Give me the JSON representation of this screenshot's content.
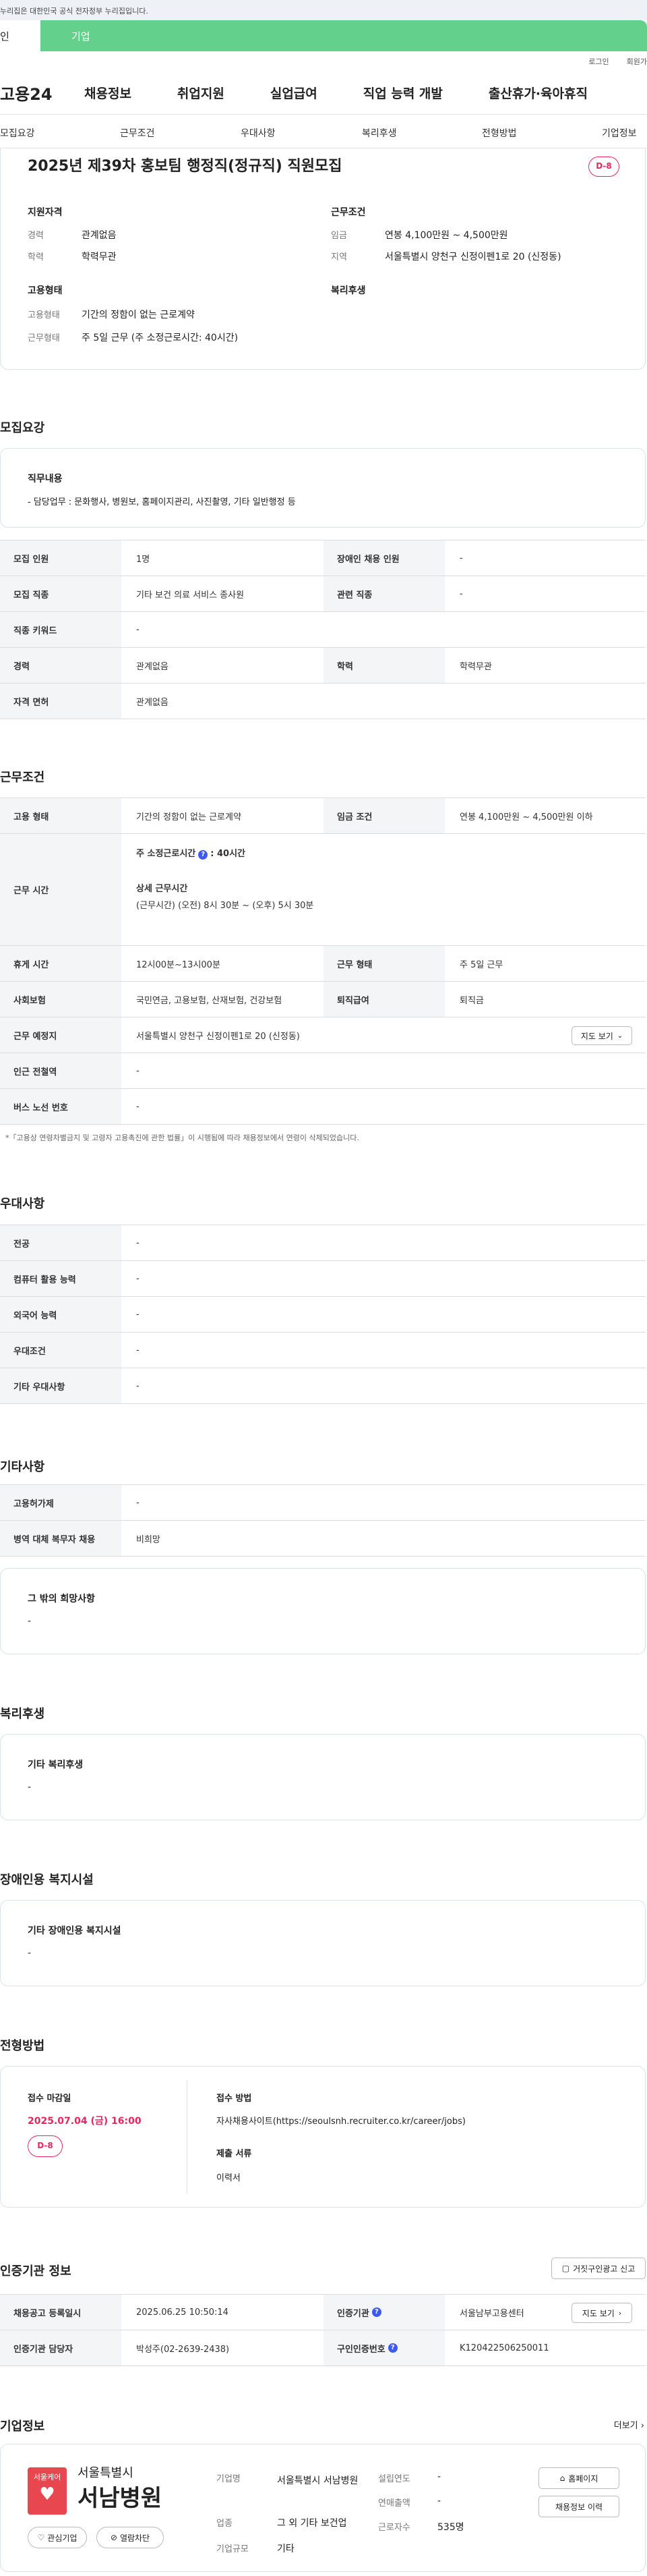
{
  "gov_banner": "누리집은 대한민국 공식 전자정부 누리집입니다.",
  "tabs": {
    "person": "인",
    "corp": "기업"
  },
  "util": {
    "login": "로그인",
    "join": "회원가"
  },
  "logo": "고용24",
  "gnb": [
    "채용정보",
    "취업지원",
    "실업급여",
    "직업 능력 개발",
    "출산휴가·육아휴직"
  ],
  "lnb": [
    "모집요강",
    "근무조건",
    "우대사항",
    "복리후생",
    "전형방법",
    "기업정보"
  ],
  "job": {
    "title": "2025년 제39차 홍보팀 행정직(정규직) 직원모집",
    "dday": "D-8",
    "qual_title": "지원자격",
    "career_l": "경력",
    "career_v": "관계없음",
    "edu_l": "학력",
    "edu_v": "학력무관",
    "cond_title": "근무조건",
    "wage_l": "임금",
    "wage_v": "연봉 4,100만원 ~ 4,500만원",
    "area_l": "지역",
    "area_v": "서울특별시 양천구 신정이펜1로 20 (신정동)",
    "emp_title": "고용형태",
    "emp_l": "고용형태",
    "emp_v": "기간의 정함이 없는 근로계약",
    "days_l": "근무형태",
    "days_v": "주 5일 근무 (주 소정근로시간: 40시간)",
    "welfare_title": "복리후생"
  },
  "recruit": {
    "heading": "모집요강",
    "duty_title": "직무내용",
    "duty_text": "- 담당업무 : 문화행사, 병원보, 홈페이지관리, 사진촬영, 기타 일반행정 등",
    "rows": [
      {
        "l1": "모집 인원",
        "v1": "1명",
        "l2": "장애인 채용 인원",
        "v2": "-"
      },
      {
        "l1": "모집 직종",
        "v1": "기타 보건 의료 서비스 종사원",
        "l2": "관련 직종",
        "v2": "-"
      },
      {
        "l1": "직종 키워드",
        "v1": "-"
      },
      {
        "l1": "경력",
        "v1": "관계없음",
        "l2": "학력",
        "v2": "학력무관"
      },
      {
        "l1": "자격 면허",
        "v1": "관계없음"
      }
    ]
  },
  "work": {
    "heading": "근무조건",
    "type_l": "고용 형태",
    "type_v": "기간의 정함이 없는 근로계약",
    "wage_l": "임금 조건",
    "wage_v": "연봉 4,100만원 ~ 4,500만원 이하",
    "time_l": "근무 시간",
    "time_h1": "주 소정근로시간",
    "time_h1v": ": 40시간",
    "time_h2": "상세 근무시간",
    "time_v2": "(근무시간) (오전) 8시 30분 ~ (오후) 5시 30분",
    "rest_l": "휴게 시간",
    "rest_v": "12시00분~13시00분",
    "form_l": "근무 형태",
    "form_v": "주 5일 근무",
    "ins_l": "사회보험",
    "ins_v": "국민연금, 고용보험, 산재보험, 건강보험",
    "ret_l": "퇴직급여",
    "ret_v": "퇴직금",
    "place_l": "근무 예정지",
    "place_v": "서울특별시 양천구 신정이펜1로 20 (신정동)",
    "map_btn": "지도 보기",
    "sub_l": "인근 전철역",
    "sub_v": "-",
    "bus_l": "버스 노선 번호",
    "bus_v": "-",
    "note": "*「고용상 연령차별금지 및 고령자 고용촉진에 관한 법률」이 시행됨에 따라 채용정보에서 연령이 삭제되었습니다."
  },
  "pref": {
    "heading": "우대사항",
    "rows": [
      {
        "l": "전공",
        "v": "-"
      },
      {
        "l": "컴퓨터 활용 능력",
        "v": "-"
      },
      {
        "l": "외국어 능력",
        "v": "-"
      },
      {
        "l": "우대조건",
        "v": "-"
      },
      {
        "l": "기타 우대사항",
        "v": "-"
      }
    ]
  },
  "etc": {
    "heading": "기타사항",
    "rows": [
      {
        "l": "고용허가제",
        "v": "-"
      },
      {
        "l": "병역 대체 복무자 채용",
        "v": "비희망"
      }
    ],
    "other_title": "그 밖의 희망사항",
    "other_v": "-"
  },
  "welfare": {
    "heading": "복리후생",
    "box_title": "기타 복리후생",
    "box_v": "-"
  },
  "disab": {
    "heading": "장애인용 복지시설",
    "box_title": "기타 장애인용 복지시설",
    "box_v": "-"
  },
  "screen": {
    "heading": "전형방법",
    "deadline_l": "접수 마감일",
    "deadline_v": "2025.07.04 (금) 16:00",
    "dday": "D-8",
    "method_l": "접수 방법",
    "method_v": "자사채용사이트(https://seoulsnh.recruiter.co.kr/career/jobs)",
    "docs_l": "제출 서류",
    "docs_v": "이력서"
  },
  "cert": {
    "heading": "인증기관 정보",
    "report_btn": "거짓구인광고 신고",
    "reg_l": "채용공고 등록일시",
    "reg_v": "2025.06.25 10:50:14",
    "org_l": "인증기관",
    "org_v": "서울남부고용센터",
    "map_btn": "지도 보기",
    "mgr_l": "인증기관 담당자",
    "mgr_v": "박성주(02-2639-2438)",
    "num_l": "구인인증번호",
    "num_v": "K120422506250011"
  },
  "company": {
    "heading": "기업정보",
    "more": "더보기",
    "logo_top": "서울특별시",
    "logo_badge": "서울케어",
    "logo_main": "서남병원",
    "fav": "관심기업",
    "block": "열람차단",
    "name_l": "기업명",
    "name_v": "서울특별시 서남병원",
    "ind_l": "업종",
    "ind_v": "그 외 기타 보건업",
    "size_l": "기업규모",
    "size_v": "기타",
    "est_l": "설립연도",
    "est_v": "-",
    "sales_l": "연매출액",
    "sales_v": "-",
    "emp_l": "근로자수",
    "emp_v": "535명",
    "home_btn": "홈페이지",
    "jobs_btn": "채용정보 이력"
  },
  "colors": {
    "green": "#63d18c",
    "pink": "#e8265e",
    "blue": "#3d5af1"
  }
}
